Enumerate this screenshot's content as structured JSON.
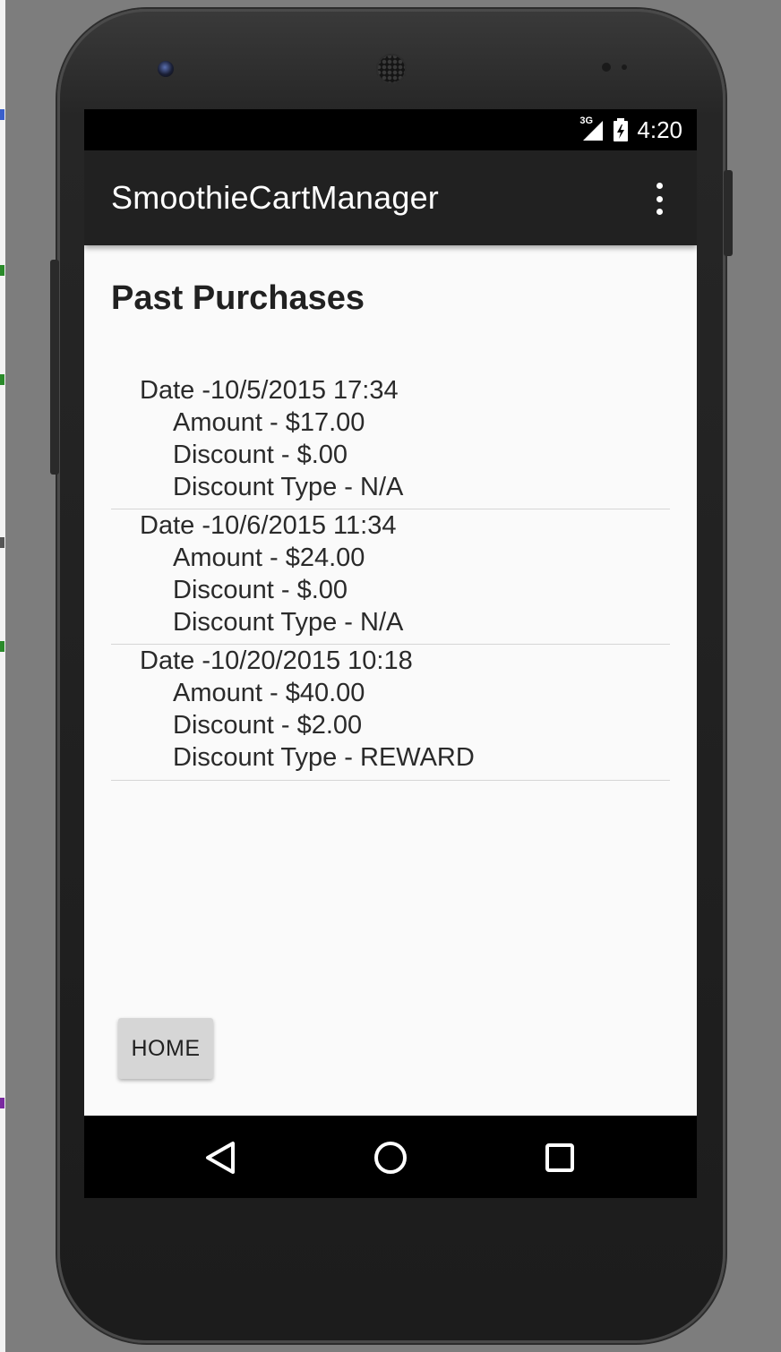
{
  "status_bar": {
    "network_label": "3G",
    "time": "4:20",
    "icons": [
      "signal-icon",
      "battery-icon"
    ]
  },
  "app_bar": {
    "title": "SmoothieCartManager",
    "menu_icon": "overflow-menu-icon"
  },
  "page": {
    "title": "Past Purchases"
  },
  "purchases": [
    {
      "date": "Date -10/5/2015 17:34",
      "amount": "Amount - $17.00",
      "discount": "Discount - $.00",
      "discount_type": "Discount Type - N/A"
    },
    {
      "date": "Date -10/6/2015 11:34",
      "amount": "Amount - $24.00",
      "discount": "Discount - $.00",
      "discount_type": "Discount Type - N/A"
    },
    {
      "date": "Date -10/20/2015 10:18",
      "amount": "Amount - $40.00",
      "discount": "Discount - $2.00",
      "discount_type": "Discount Type - REWARD"
    }
  ],
  "home_button": {
    "label": "HOME"
  },
  "nav_bar": {
    "icons": [
      "back-icon",
      "home-icon",
      "recents-icon"
    ]
  },
  "colors": {
    "app_bar": "#212121",
    "background": "#fafafa",
    "button": "#d6d6d6"
  }
}
